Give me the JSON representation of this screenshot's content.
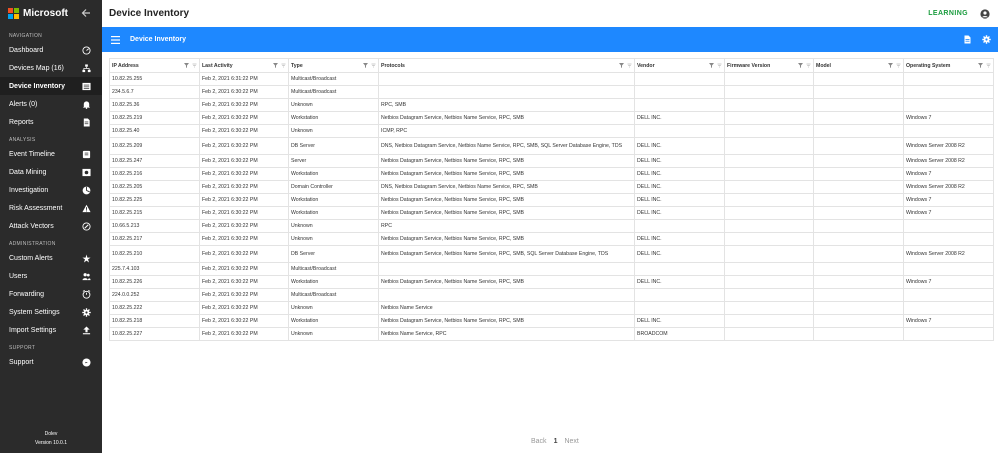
{
  "app": {
    "brand": "Microsoft"
  },
  "sidebar": {
    "sections": [
      {
        "label": "NAVIGATION",
        "items": [
          {
            "label": "Dashboard",
            "icon": "dashboard-icon"
          },
          {
            "label": "Devices Map (16)",
            "icon": "network-map-icon"
          },
          {
            "label": "Device Inventory",
            "icon": "inventory-icon",
            "active": true
          },
          {
            "label": "Alerts (0)",
            "icon": "bell-icon"
          },
          {
            "label": "Reports",
            "icon": "reports-icon"
          }
        ]
      },
      {
        "label": "ANALYSIS",
        "items": [
          {
            "label": "Event Timeline",
            "icon": "timeline-icon"
          },
          {
            "label": "Data Mining",
            "icon": "data-mining-icon"
          },
          {
            "label": "Investigation",
            "icon": "investigation-icon"
          },
          {
            "label": "Risk Assessment",
            "icon": "warning-icon"
          },
          {
            "label": "Attack Vectors",
            "icon": "attack-vector-icon"
          }
        ]
      },
      {
        "label": "ADMINISTRATION",
        "items": [
          {
            "label": "Custom Alerts",
            "icon": "custom-alerts-icon"
          },
          {
            "label": "Users",
            "icon": "users-icon"
          },
          {
            "label": "Forwarding",
            "icon": "forwarding-icon"
          },
          {
            "label": "System Settings",
            "icon": "gear-icon"
          },
          {
            "label": "Import Settings",
            "icon": "upload-icon"
          }
        ]
      },
      {
        "label": "SUPPORT",
        "items": [
          {
            "label": "Support",
            "icon": "support-icon"
          }
        ]
      }
    ],
    "footer": {
      "line1": "Dolev",
      "line2": "Version 10.0.1"
    }
  },
  "header": {
    "title": "Device Inventory",
    "learning": "LEARNING"
  },
  "bluebar": {
    "title": "Device Inventory"
  },
  "table": {
    "columns": [
      "IP Address",
      "Last Activity",
      "Type",
      "Protocols",
      "Vendor",
      "Firmware Version",
      "Model",
      "Operating System"
    ],
    "rows": [
      [
        "10.82.25.255",
        "Feb 2, 2021 6:31:22 PM",
        "Multicast/Broadcast",
        "",
        "",
        "",
        "",
        ""
      ],
      [
        "234.5.6.7",
        "Feb 2, 2021 6:30:22 PM",
        "Multicast/Broadcast",
        "",
        "",
        "",
        "",
        ""
      ],
      [
        "10.82.25.36",
        "Feb 2, 2021 6:30:22 PM",
        "Unknown",
        "RPC, SMB",
        "",
        "",
        "",
        ""
      ],
      [
        "10.82.25.219",
        "Feb 2, 2021 6:30:22 PM",
        "Workstation",
        "Netbios Datagram Service, Netbios Name Service, RPC, SMB",
        "DELL INC.",
        "",
        "",
        "Windows 7"
      ],
      [
        "10.82.25.40",
        "Feb 2, 2021 6:30:22 PM",
        "Unknown",
        "ICMP, RPC",
        "",
        "",
        "",
        ""
      ],
      [
        "10.82.25.209",
        "Feb 2, 2021 6:30:22 PM",
        "DB Server",
        "DNS, Netbios Datagram Service, Netbios Name Service, RPC, SMB, SQL Server Database Engine, TDS",
        "DELL INC.",
        "",
        "",
        "Windows Server 2008 R2"
      ],
      [
        "10.82.25.247",
        "Feb 2, 2021 6:30:22 PM",
        "Server",
        "Netbios Datagram Service, Netbios Name Service, RPC, SMB",
        "DELL INC.",
        "",
        "",
        "Windows Server 2008 R2"
      ],
      [
        "10.82.25.216",
        "Feb 2, 2021 6:30:22 PM",
        "Workstation",
        "Netbios Datagram Service, Netbios Name Service, RPC, SMB",
        "DELL INC.",
        "",
        "",
        "Windows 7"
      ],
      [
        "10.82.25.205",
        "Feb 2, 2021 6:30:22 PM",
        "Domain Controller",
        "DNS, Netbios Datagram Service, Netbios Name Service, RPC, SMB",
        "DELL INC.",
        "",
        "",
        "Windows Server 2008 R2"
      ],
      [
        "10.82.25.225",
        "Feb 2, 2021 6:30:22 PM",
        "Workstation",
        "Netbios Datagram Service, Netbios Name Service, RPC, SMB",
        "DELL INC.",
        "",
        "",
        "Windows 7"
      ],
      [
        "10.82.25.215",
        "Feb 2, 2021 6:30:22 PM",
        "Workstation",
        "Netbios Datagram Service, Netbios Name Service, RPC, SMB",
        "DELL INC.",
        "",
        "",
        "Windows 7"
      ],
      [
        "10.66.5.213",
        "Feb 2, 2021 6:30:22 PM",
        "Unknown",
        "RPC",
        "",
        "",
        "",
        ""
      ],
      [
        "10.82.25.217",
        "Feb 2, 2021 6:30:22 PM",
        "Unknown",
        "Netbios Datagram Service, Netbios Name Service, RPC, SMB",
        "DELL INC.",
        "",
        "",
        ""
      ],
      [
        "10.82.25.210",
        "Feb 2, 2021 6:30:22 PM",
        "DB Server",
        "Netbios Datagram Service, Netbios Name Service, RPC, SMB, SQL Server Database Engine, TDS",
        "DELL INC.",
        "",
        "",
        "Windows Server 2008 R2"
      ],
      [
        "225.7.4.103",
        "Feb 2, 2021 6:30:22 PM",
        "Multicast/Broadcast",
        "",
        "",
        "",
        "",
        ""
      ],
      [
        "10.82.25.226",
        "Feb 2, 2021 6:30:22 PM",
        "Workstation",
        "Netbios Datagram Service, Netbios Name Service, RPC, SMB",
        "DELL INC.",
        "",
        "",
        "Windows 7"
      ],
      [
        "224.0.0.252",
        "Feb 2, 2021 6:30:22 PM",
        "Multicast/Broadcast",
        "",
        "",
        "",
        "",
        ""
      ],
      [
        "10.82.25.222",
        "Feb 2, 2021 6:30:22 PM",
        "Unknown",
        "Netbios Name Service",
        "",
        "",
        "",
        ""
      ],
      [
        "10.82.25.218",
        "Feb 2, 2021 6:30:22 PM",
        "Workstation",
        "Netbios Datagram Service, Netbios Name Service, RPC, SMB",
        "DELL INC.",
        "",
        "",
        "Windows 7"
      ],
      [
        "10.82.25.227",
        "Feb 2, 2021 6:30:22 PM",
        "Unknown",
        "Netbios Name Service, RPC",
        "BROADCOM",
        "",
        "",
        ""
      ]
    ]
  },
  "pager": {
    "back": "Back",
    "current": "1",
    "next": "Next"
  },
  "colors": {
    "accent": "#1e88ff",
    "sidebar": "#2b2b2b",
    "learning": "#1a9c3e"
  }
}
